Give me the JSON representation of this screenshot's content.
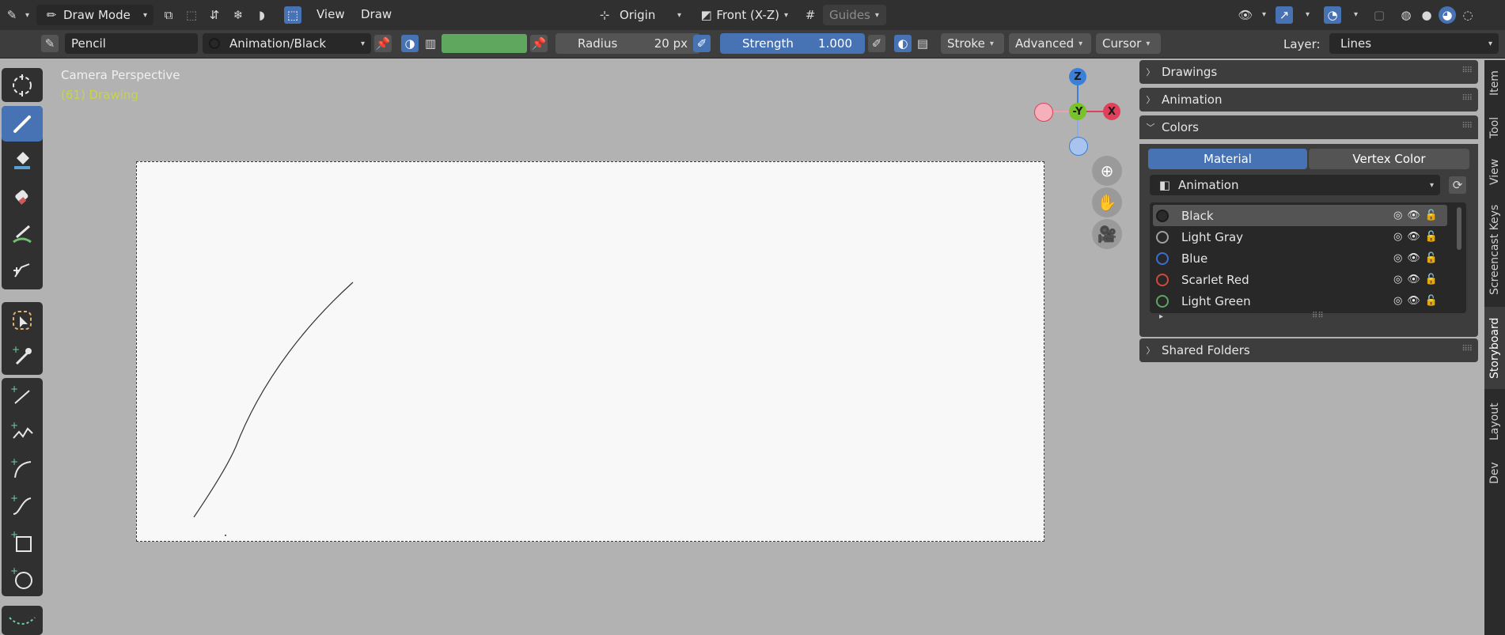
{
  "header": {
    "mode_label": "Draw Mode",
    "menus": [
      "View",
      "Draw"
    ],
    "origin_label": "Origin",
    "view_label": "Front (X-Z)",
    "guides_label": "Guides"
  },
  "toolbar": {
    "brush_name": "Pencil",
    "material_label": "Animation/Black",
    "radius_label": "Radius",
    "radius_value": "20 px",
    "strength_label": "Strength",
    "strength_value": "1.000",
    "stroke_label": "Stroke",
    "advanced_label": "Advanced",
    "cursor_label": "Cursor",
    "layer_label": "Layer:",
    "layer_value": "Lines",
    "color_swatch": "#5fa65f"
  },
  "viewport": {
    "camera_label": "Camera Perspective",
    "object_label": "(61) Drawing",
    "gizmo": {
      "z": "Z",
      "y": "-Y",
      "x": "X"
    }
  },
  "tools": [
    "cursor-icon",
    "draw-icon",
    "fill-icon",
    "erase-icon",
    "tint-icon",
    "cutter-icon",
    "box-select-icon",
    "eyedropper-icon",
    "line-icon",
    "polyline-icon",
    "arc-icon",
    "curve-icon",
    "box-icon",
    "circle-icon",
    "interpolate-icon"
  ],
  "panel": {
    "drawings": "Drawings",
    "animation": "Animation",
    "colors": "Colors",
    "tab_material": "Material",
    "tab_vertex": "Vertex Color",
    "palette": "Animation",
    "materials": [
      {
        "name": "Black",
        "color": "#1a1a1a"
      },
      {
        "name": "Light Gray",
        "color": "#a0a0a0"
      },
      {
        "name": "Blue",
        "color": "#3a6fd0"
      },
      {
        "name": "Scarlet Red",
        "color": "#d04a3a"
      },
      {
        "name": "Light Green",
        "color": "#5fa65f"
      }
    ],
    "shared_folders": "Shared Folders"
  },
  "side_tabs": [
    "Item",
    "Tool",
    "View",
    "Screencast Keys",
    "Storyboard",
    "Layout",
    "Dev"
  ]
}
